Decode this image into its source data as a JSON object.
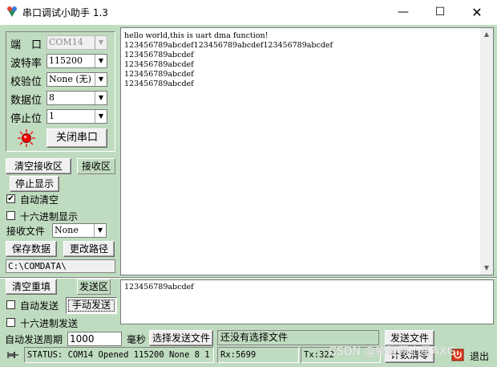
{
  "window": {
    "title": "串口调试小助手 1.3",
    "minimize_glyph": "—",
    "maximize_glyph": "☐",
    "close_glyph": "✕"
  },
  "settings": {
    "port_label": "端　口",
    "port_value": "COM14",
    "baud_label": "波特率",
    "baud_value": "115200",
    "parity_label": "校验位",
    "parity_value": "None (无)",
    "databits_label": "数据位",
    "databits_value": "8",
    "stopbits_label": "停止位",
    "stopbits_value": "1",
    "close_port_label": "关闭串口",
    "lamp_color": "#ff0000"
  },
  "receive": {
    "clear_label": "清空接收区",
    "area_label": "接收区",
    "stop_display_label": "停止显示",
    "auto_clear_label": "自动清空",
    "auto_clear_checked": true,
    "hex_display_label": "十六进制显示",
    "hex_display_checked": false,
    "file_label": "接收文件",
    "file_format": "None",
    "save_data_label": "保存数据",
    "change_path_label": "更改路径",
    "path": "C:\\COMDATA\\",
    "lines": [
      "hello world,this is uart dma function!",
      "123456789abcdef123456789abcdef123456789abcdef",
      "123456789abcdef",
      "123456789abcdef",
      "123456789abcdef",
      "123456789abcdef"
    ]
  },
  "send": {
    "clear_label": "清空重填",
    "area_label": "发送区",
    "auto_send_label": "自动发送",
    "auto_send_checked": false,
    "manual_send_label": "手动发送",
    "hex_send_label": "十六进制发送",
    "hex_send_checked": false,
    "period_label": "自动发送周期",
    "period_value": "1000",
    "period_unit": "毫秒",
    "choose_file_label": "选择发送文件",
    "file_status": "还没有选择文件",
    "send_file_label": "发送文件",
    "text": "123456789abcdef"
  },
  "status": {
    "status_text": "STATUS: COM14 Opened 115200 None  8 1",
    "rx_text": "Rx:5699",
    "tx_text": "Tx:322",
    "reset_count_label": "计数清零",
    "exit_label": "退出"
  },
  "watermark": "CSDN @物联网小星AXG",
  "colors": {
    "client_bg": "#c0dcc0",
    "button_bg": "#f0f0f0"
  }
}
